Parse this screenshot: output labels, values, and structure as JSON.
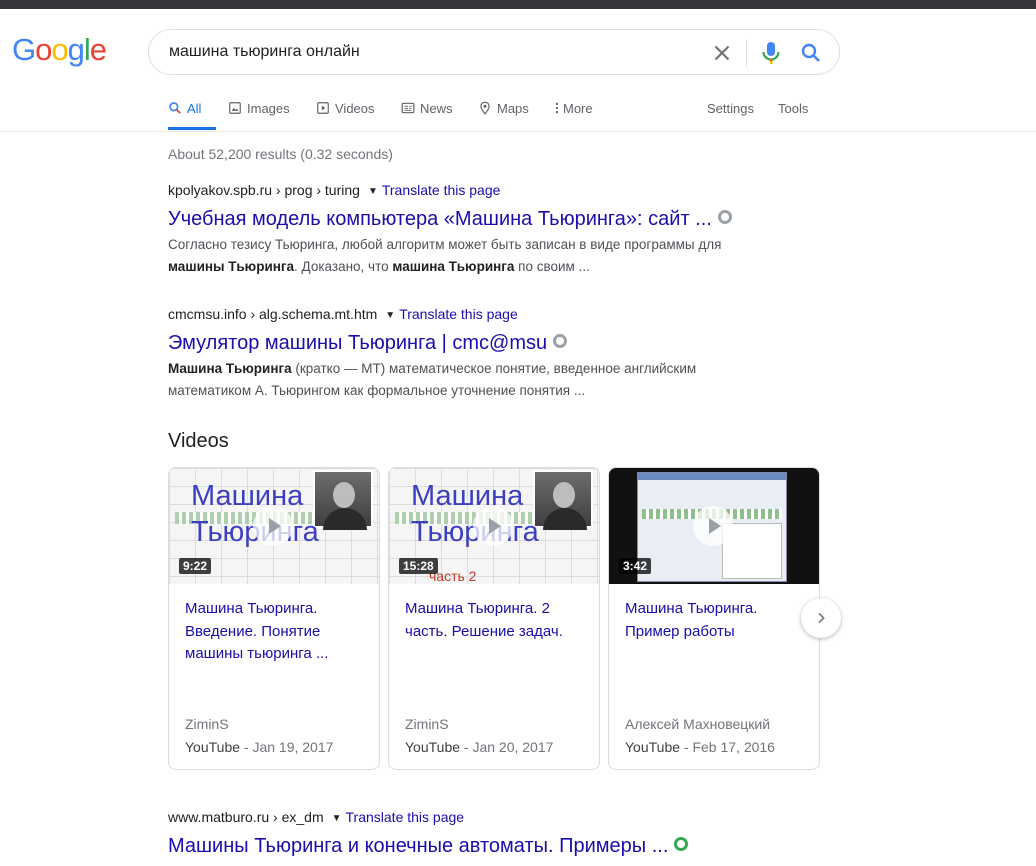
{
  "logo": {
    "text": "Google",
    "letters": [
      "G",
      "o",
      "o",
      "g",
      "l",
      "e"
    ],
    "colors": [
      "#4285f4",
      "#ea4335",
      "#fbbc05",
      "#4285f4",
      "#34a853",
      "#ea4335"
    ]
  },
  "search": {
    "query": "машина тьюринга онлайн"
  },
  "tabs": [
    {
      "label": "All",
      "icon": "search-icon",
      "active": true
    },
    {
      "label": "Images",
      "icon": "image-icon"
    },
    {
      "label": "Videos",
      "icon": "video-icon"
    },
    {
      "label": "News",
      "icon": "news-icon"
    },
    {
      "label": "Maps",
      "icon": "map-pin-icon"
    },
    {
      "label": "More",
      "icon": "more-dots-icon"
    }
  ],
  "tools": {
    "settings": "Settings",
    "tools": "Tools"
  },
  "stats": "About 52,200 results (0.32 seconds)",
  "results": [
    {
      "cite": "kpolyakov.spb.ru › prog › turing",
      "translate": "Translate this page",
      "title": "Учебная модель компьютера «Машина Тьюринга»: сайт ...",
      "snippet_line1": "Согласно тезису Тьюринга, любой алгоритм может быть записан в виде программы для",
      "snippet_b1": "машины Тьюринга",
      "snippet_t1": ". Доказано, что ",
      "snippet_b2": "машина Тьюринга",
      "snippet_t2": " по своим ..."
    },
    {
      "cite": "cmcmsu.info › alg.schema.mt.htm",
      "translate": "Translate this page",
      "title": "Эмулятор машины Тьюринга | cmc@msu",
      "snippet_b1": "Машина Тьюринга",
      "snippet_t1": " (кратко — МТ) математическое понятие, введенное английским",
      "snippet_line2": "математиком А. Тьюрингом как формальное уточнение понятия ..."
    },
    {
      "cite": "www.matburo.ru › ex_dm",
      "translate": "Translate this page",
      "title": "Машины Тьюринга и конечные автоматы. Примеры ..."
    }
  ],
  "videos": {
    "heading": "Videos",
    "items": [
      {
        "thumb_text_1": "Машина",
        "thumb_text_2": "Тьюринга",
        "thumb_sub": "",
        "duration": "9:22",
        "title": "Машина Тьюринга. Введение. Понятие машины тьюринга ...",
        "channel": "ZiminS",
        "source": "YouTube",
        "date": " - Jan 19, 2017"
      },
      {
        "thumb_text_1": "Машина",
        "thumb_text_2": "Тьюринга",
        "thumb_sub": "часть 2",
        "duration": "15:28",
        "title": "Машина Тьюринга. 2 часть. Решение задач.",
        "channel": "ZiminS",
        "source": "YouTube",
        "date": " - Jan 20, 2017"
      },
      {
        "duration": "3:42",
        "title": "Машина Тьюринга. Пример работы",
        "channel": "Алексей Махновецкий",
        "source": "YouTube",
        "date": " - Feb 17, 2016"
      }
    ]
  }
}
